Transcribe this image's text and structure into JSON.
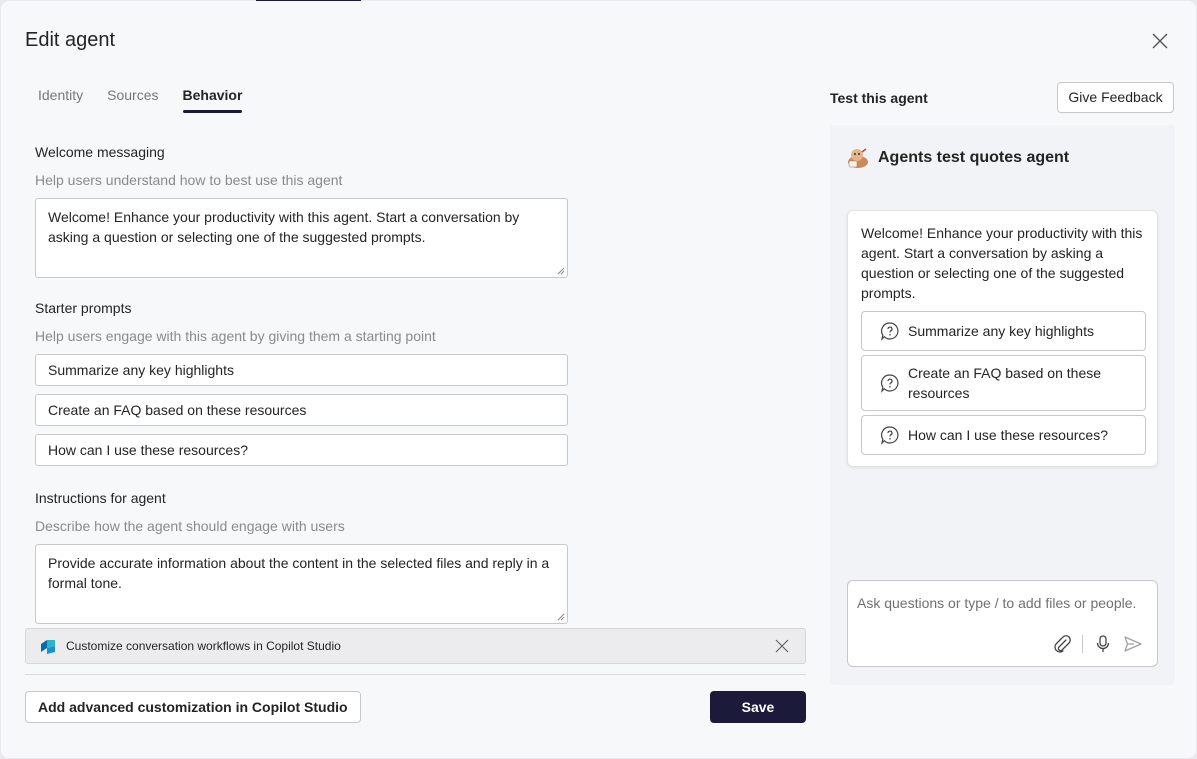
{
  "dialog": {
    "title": "Edit agent"
  },
  "tabs": [
    {
      "label": "Identity"
    },
    {
      "label": "Sources"
    },
    {
      "label": "Behavior"
    }
  ],
  "welcome": {
    "label": "Welcome messaging",
    "help": "Help users understand how to best use this agent",
    "value": "Welcome! Enhance your productivity with this agent. Start a conversation by asking a question or selecting one of the suggested prompts."
  },
  "starters": {
    "label": "Starter prompts",
    "help": "Help users engage with this agent by giving them a starting point",
    "items": [
      "Summarize any key highlights",
      "Create an FAQ based on these resources",
      "How can I use these resources?"
    ]
  },
  "instructions": {
    "label": "Instructions for agent",
    "help": "Describe how the agent should engage with users",
    "value": "Provide accurate information about the content in the selected files and reply in a formal tone."
  },
  "banner": {
    "label": "Customize conversation workflows in Copilot Studio"
  },
  "footer": {
    "advanced_label": "Add advanced customization in Copilot Studio",
    "save_label": "Save"
  },
  "test": {
    "title": "Test this agent",
    "feedback_label": "Give Feedback",
    "agent_name": "Agents test quotes agent",
    "welcome_text": "Welcome! Enhance your productivity with this agent. Start a conversation by asking a question or selecting one of the suggested prompts.",
    "suggestions": [
      "Summarize any key highlights",
      "Create an FAQ based on these resources",
      "How can I use these resources?"
    ],
    "input_placeholder": "Ask questions or type / to add files or people."
  },
  "colors": {
    "accent": "#1b1a3a",
    "background": "#f7f8fa"
  }
}
